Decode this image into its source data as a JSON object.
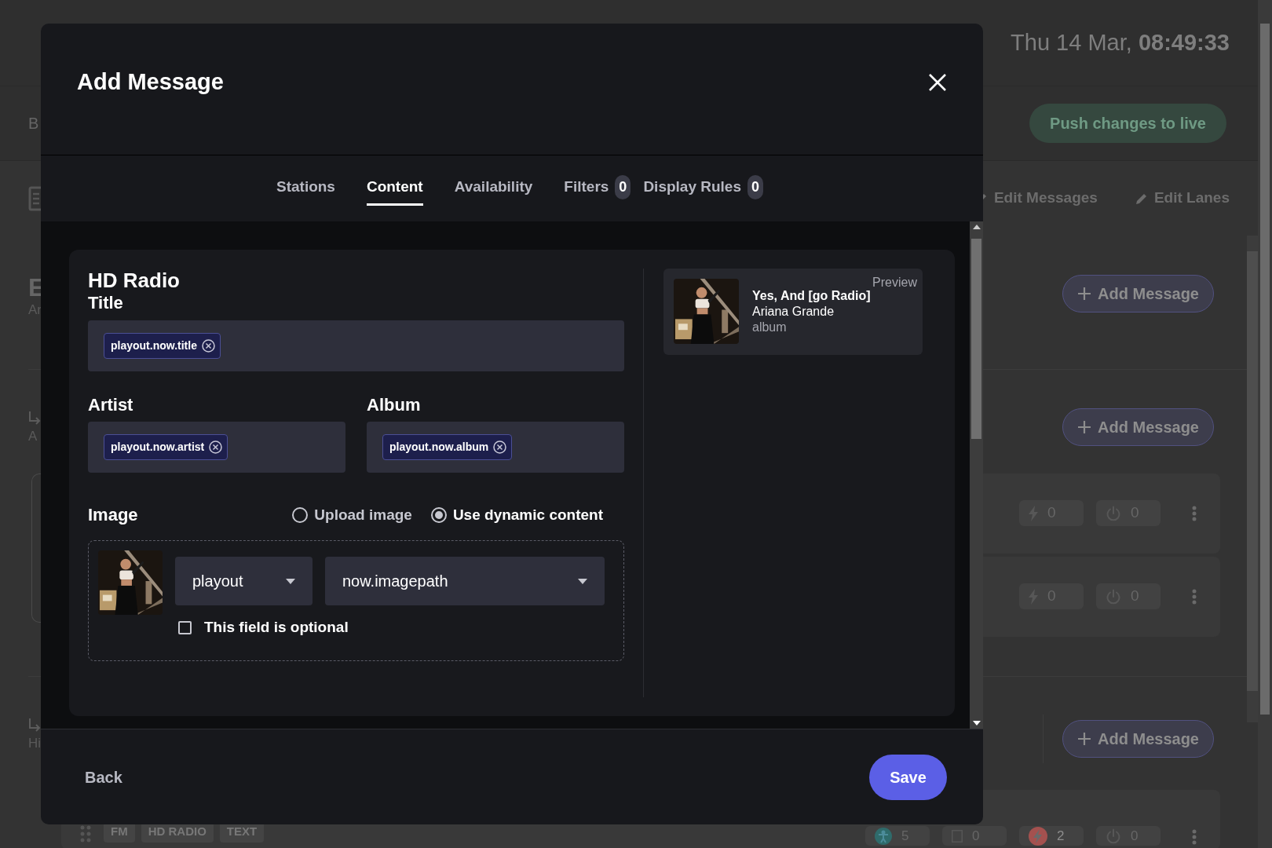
{
  "app": {
    "clock": "Thu 14 Mar, **08:49:33**",
    "crumb": "B",
    "push_button": "Push changes to live",
    "toolbar": [
      "Edit Messages",
      "Edit Lanes"
    ],
    "header_section": {
      "title": "E",
      "subtitle": "Ar",
      "add_button": "Add Message"
    },
    "lanes": [
      {
        "name": "A",
        "add_button": "Add Message",
        "messages": [
          {
            "stats": [
              {
                "kind": "bolt",
                "value": "0",
                "alert": false
              },
              {
                "kind": "power",
                "value": "0",
                "alert": false
              }
            ]
          },
          {
            "stats": [
              {
                "kind": "bolt",
                "value": "0",
                "alert": false
              },
              {
                "kind": "power",
                "value": "0",
                "alert": false
              }
            ]
          }
        ]
      },
      {
        "name": "Hi",
        "add_button": "Add Message",
        "messages": [
          {
            "tags": [
              "FM",
              "HD RADIO",
              "TEXT"
            ],
            "stats": [
              {
                "kind": "person",
                "value": "5",
                "alert": false
              },
              {
                "kind": "square",
                "value": "0",
                "alert": false
              },
              {
                "kind": "bolt",
                "value": "2",
                "alert": true
              },
              {
                "kind": "power",
                "value": "0",
                "alert": false
              }
            ]
          }
        ]
      }
    ]
  },
  "modal": {
    "title": "Add Message",
    "tabs": [
      {
        "label": "Stations",
        "selected": false
      },
      {
        "label": "Content",
        "selected": true
      },
      {
        "label": "Availability",
        "selected": false
      },
      {
        "label": "Filters",
        "count": "0",
        "selected": false
      },
      {
        "label": "Display Rules",
        "count": "0",
        "selected": false
      }
    ],
    "section": "HD Radio",
    "fields": [
      {
        "label": "Title",
        "tokens": [
          "playout.now.title"
        ]
      },
      {
        "label": "Artist",
        "tokens": [
          "playout.now.artist"
        ]
      },
      {
        "label": "Album",
        "tokens": [
          "playout.now.album"
        ]
      }
    ],
    "image": {
      "label": "Image",
      "options": [
        {
          "label": "Upload image",
          "selected": false
        },
        {
          "label": "Use dynamic content",
          "selected": true
        }
      ],
      "source": "playout",
      "path": "now.imagepath",
      "optional": {
        "label": "This field is optional",
        "checked": false
      }
    },
    "preview": {
      "label": "Preview",
      "title": "Yes, And [go Radio]",
      "artist": "Ariana Grande",
      "album": "album"
    },
    "footer": {
      "back": "Back",
      "save": "Save"
    }
  }
}
